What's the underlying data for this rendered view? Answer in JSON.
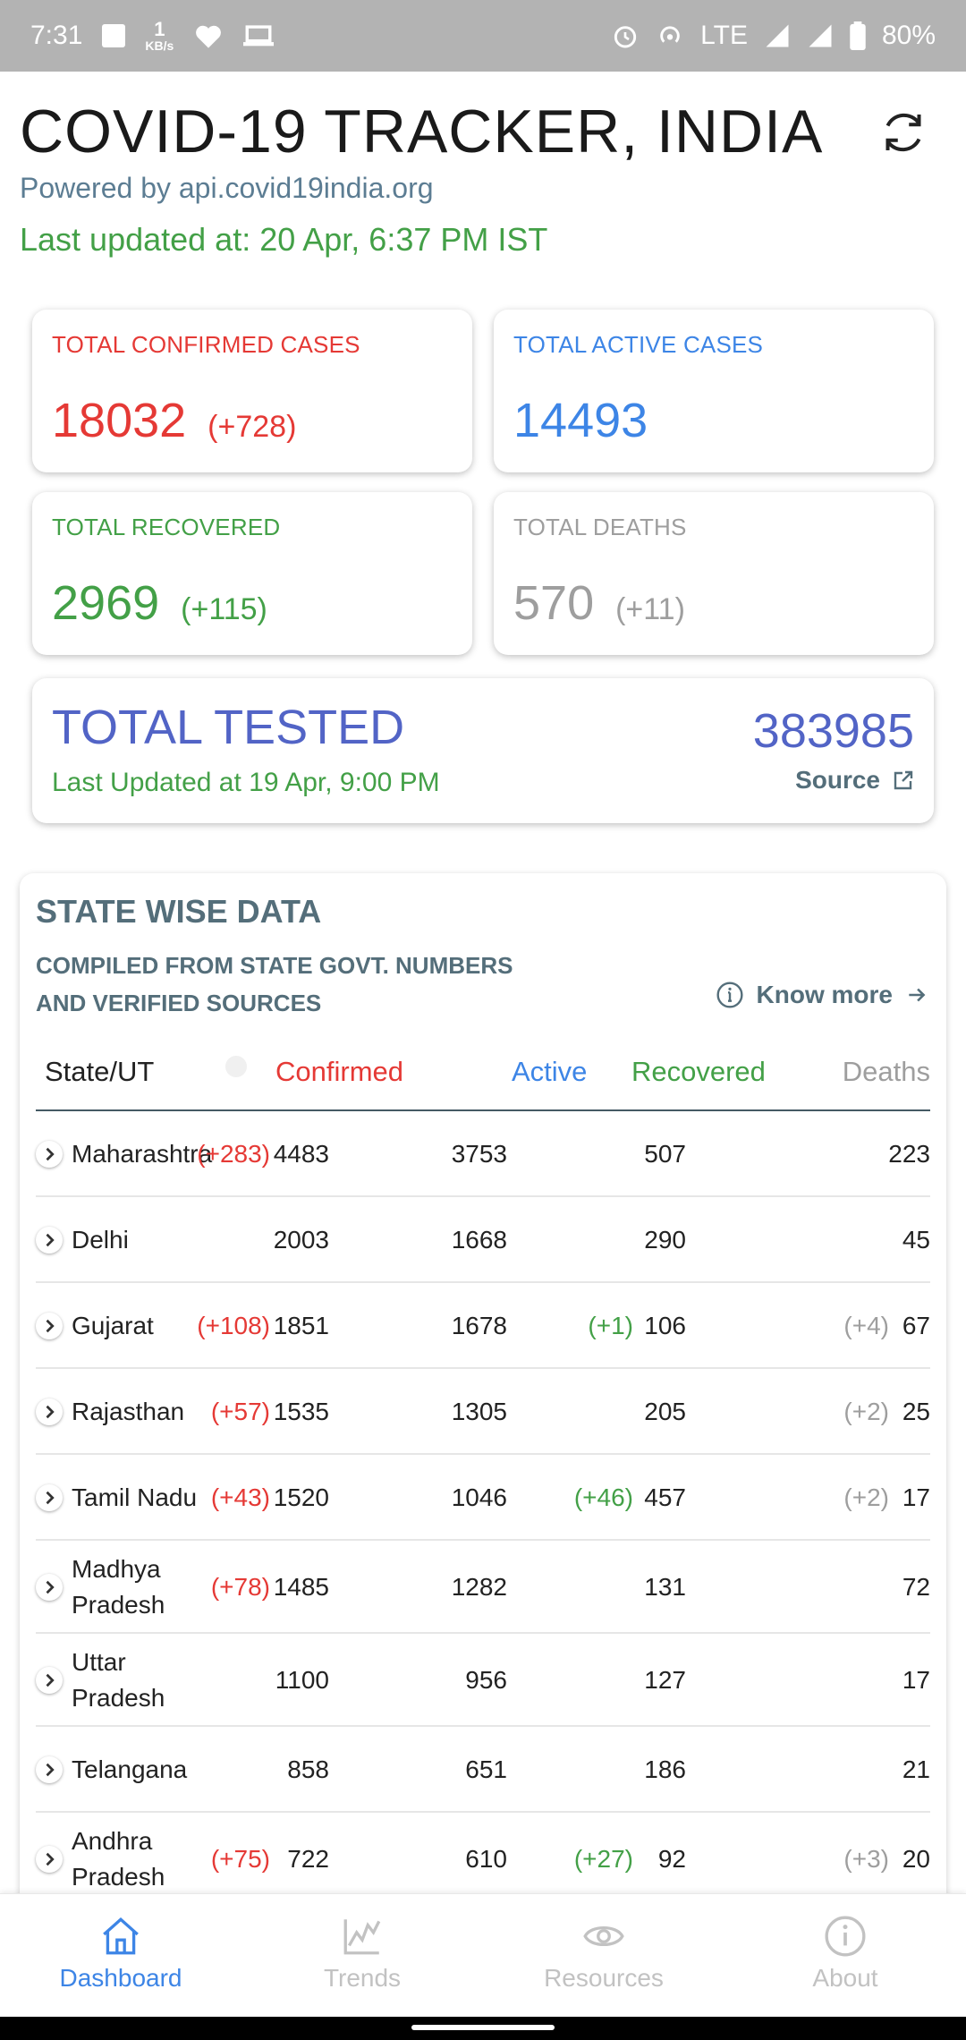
{
  "status_bar": {
    "time": "7:31",
    "speed_value": "1",
    "speed_unit": "KB/s",
    "network": "LTE",
    "battery": "80%"
  },
  "header": {
    "title": "COVID-19 TRACKER, INDIA",
    "powered_by": "Powered by api.covid19india.org",
    "last_updated": "Last updated at: 20 Apr,  6:37 PM IST",
    "refresh_icon": "refresh-icon"
  },
  "cards": {
    "confirmed": {
      "label": "TOTAL CONFIRMED CASES",
      "value": "18032",
      "delta": "(+728)",
      "color": "#e53935"
    },
    "active": {
      "label": "TOTAL ACTIVE CASES",
      "value": "14493",
      "delta": "",
      "color": "#3d85e6"
    },
    "recovered": {
      "label": "TOTAL RECOVERED",
      "value": "2969",
      "delta": "(+115)",
      "color": "#43a047"
    },
    "deaths": {
      "label": "TOTAL DEATHS",
      "value": "570",
      "delta": "(+11)",
      "color": "#9e9e9e"
    }
  },
  "tested": {
    "label": "TOTAL TESTED",
    "value": "383985",
    "updated": "Last Updated at 19 Apr,  9:00 PM",
    "source_label": "Source"
  },
  "state_wise": {
    "title": "STATE WISE DATA",
    "subtitle": "COMPILED FROM STATE GOVT. NUMBERS AND VERIFIED SOURCES",
    "know_more": "Know more",
    "columns": [
      "State/UT",
      "Confirmed",
      "Active",
      "Recovered",
      "Deaths"
    ],
    "rows": [
      {
        "state": "Maharashtra",
        "conf_delta": "(+283)",
        "confirmed": "4483",
        "active": "3753",
        "rec_delta": "",
        "recovered": "507",
        "death_delta": "",
        "deaths": "223"
      },
      {
        "state": "Delhi",
        "conf_delta": "",
        "confirmed": "2003",
        "active": "1668",
        "rec_delta": "",
        "recovered": "290",
        "death_delta": "",
        "deaths": "45"
      },
      {
        "state": "Gujarat",
        "conf_delta": "(+108)",
        "confirmed": "1851",
        "active": "1678",
        "rec_delta": "(+1)",
        "recovered": "106",
        "death_delta": "(+4)",
        "deaths": "67"
      },
      {
        "state": "Rajasthan",
        "conf_delta": "(+57)",
        "confirmed": "1535",
        "active": "1305",
        "rec_delta": "",
        "recovered": "205",
        "death_delta": "(+2)",
        "deaths": "25"
      },
      {
        "state": "Tamil Nadu",
        "conf_delta": "(+43)",
        "confirmed": "1520",
        "active": "1046",
        "rec_delta": "(+46)",
        "recovered": "457",
        "death_delta": "(+2)",
        "deaths": "17"
      },
      {
        "state": "Madhya Pradesh",
        "conf_delta": "(+78)",
        "confirmed": "1485",
        "active": "1282",
        "rec_delta": "",
        "recovered": "131",
        "death_delta": "",
        "deaths": "72"
      },
      {
        "state": "Uttar Pradesh",
        "conf_delta": "",
        "confirmed": "1100",
        "active": "956",
        "rec_delta": "",
        "recovered": "127",
        "death_delta": "",
        "deaths": "17"
      },
      {
        "state": "Telangana",
        "conf_delta": "",
        "confirmed": "858",
        "active": "651",
        "rec_delta": "",
        "recovered": "186",
        "death_delta": "",
        "deaths": "21"
      },
      {
        "state": "Andhra Pradesh",
        "conf_delta": "(+75)",
        "confirmed": "722",
        "active": "610",
        "rec_delta": "(+27)",
        "recovered": "92",
        "death_delta": "(+3)",
        "deaths": "20"
      }
    ]
  },
  "bottom_nav": [
    {
      "label": "Dashboard",
      "icon": "home-icon",
      "active": true
    },
    {
      "label": "Trends",
      "icon": "chart-icon",
      "active": false
    },
    {
      "label": "Resources",
      "icon": "eye-icon",
      "active": false
    },
    {
      "label": "About",
      "icon": "info-icon",
      "active": false
    }
  ]
}
